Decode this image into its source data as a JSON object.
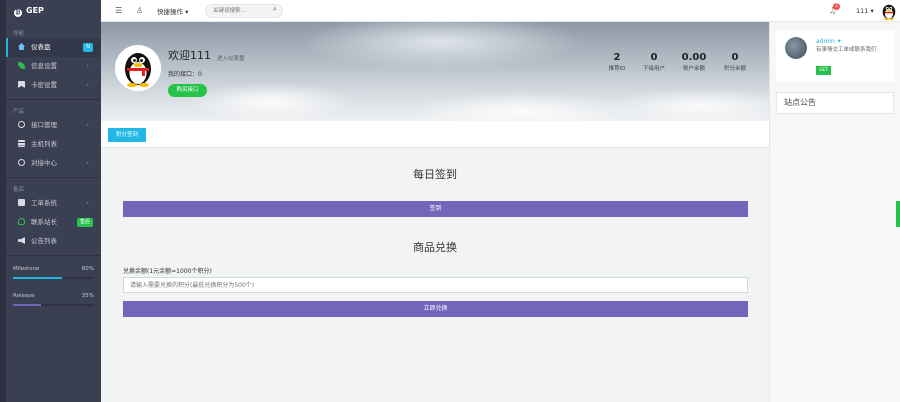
{
  "brand": {
    "name": "GEP"
  },
  "sidebar": {
    "sections": [
      {
        "title": "导航"
      },
      {
        "title": "产品"
      },
      {
        "title": "售后"
      }
    ],
    "items": [
      {
        "label": "仪表盘",
        "badge": "N",
        "badge_color": "#23b7e5",
        "icon": "home-icon",
        "icon_color": "#6cc3f5"
      },
      {
        "label": "信息设置",
        "icon": "leaf-icon",
        "icon_color": "#27c24c"
      },
      {
        "label": "卡密设置",
        "icon": "bookmark-icon",
        "icon_color": "#d8dde4"
      },
      {
        "label": "接口管理",
        "icon": "settings-icon",
        "icon_color": "#d8dde4"
      },
      {
        "label": "主机列表",
        "icon": "stack-icon",
        "icon_color": "#d8dde4"
      },
      {
        "label": "对接中心",
        "icon": "clock-icon",
        "icon_color": "#d8dde4"
      },
      {
        "label": "工单系统",
        "icon": "briefcase-icon",
        "icon_color": "#d8dde4"
      },
      {
        "label": "联系站长",
        "badge": "售后",
        "badge_color": "#27c24c",
        "icon": "user-icon",
        "icon_color": "#27c24c"
      },
      {
        "label": "公告列表",
        "icon": "megaphone-icon",
        "icon_color": "#d8dde4"
      }
    ],
    "progress": [
      {
        "label": "Milestone",
        "percent": 60,
        "value_text": "60%",
        "color": "#23b7e5"
      },
      {
        "label": "Release",
        "percent": 35,
        "value_text": "35%",
        "color": "#7266ba"
      }
    ]
  },
  "topbar": {
    "quick_label": "快捷操作",
    "search_placeholder": "关键词搜索...",
    "notification_count": "2",
    "username": "111"
  },
  "hero": {
    "welcome": "欢迎111",
    "enter_text": "进入仪表盘",
    "my_port": "我的接口：0",
    "buy_button": "购买接口",
    "stats": [
      {
        "value": "2",
        "label": "推荐ID"
      },
      {
        "value": "0",
        "label": "下级用户"
      },
      {
        "value": "0.00",
        "label": "账户余额"
      },
      {
        "value": "0",
        "label": "积分余额"
      }
    ]
  },
  "tabs": {
    "signin_tab": "积分签到"
  },
  "main": {
    "daily_title": "每日签到",
    "signin_button": "签到",
    "exchange_title": "商品兑换",
    "balance_label": "兑换余额(1元余额=1000个积分)",
    "input_placeholder": "请输入需要兑换的积分(最低兑换积分为500个)",
    "exchange_button": "立即兑换"
  },
  "right_panel": {
    "admin_name": "admin",
    "admin_desc": "有事情交工单或联系我们",
    "get_button": "GET",
    "notice_title": "站点公告"
  },
  "colors": {
    "sidebar": "#3a3f51",
    "accent": "#23b7e5",
    "purple": "#7266ba",
    "green": "#27c24c"
  }
}
